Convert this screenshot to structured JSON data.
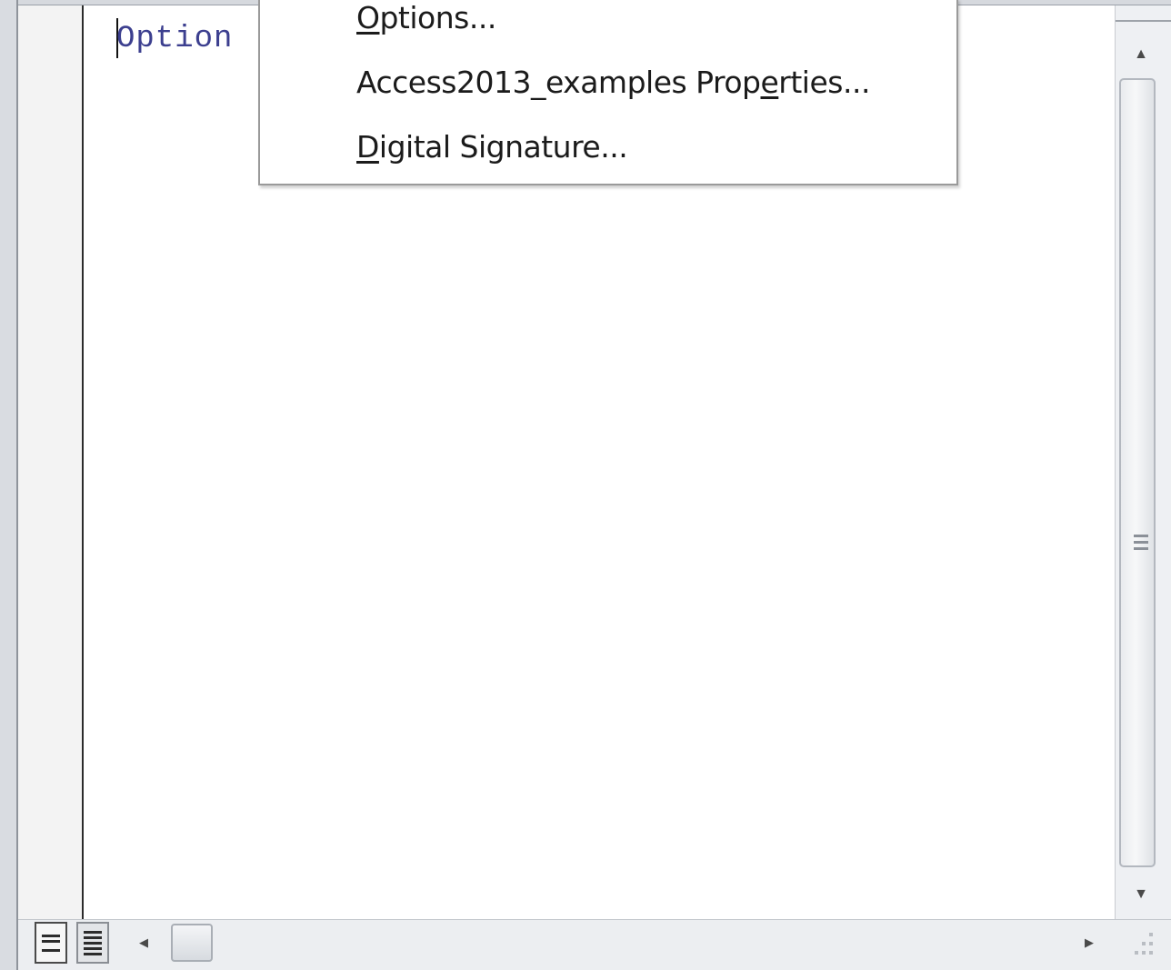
{
  "editor": {
    "code_text": "Option"
  },
  "context_menu": {
    "items": [
      {
        "mnemonic": "O",
        "rest": "ptions..."
      },
      {
        "before": "Access2013_examples Prop",
        "mnemonic": "e",
        "after": "rties..."
      },
      {
        "mnemonic": "D",
        "rest": "igital Signature..."
      }
    ]
  },
  "scrollbars": {
    "up_arrow": "▲",
    "down_arrow": "▼",
    "left_arrow": "◀",
    "right_arrow": "▶"
  },
  "icons": {
    "procedure_view": "procedure-view-icon",
    "full_module_view": "full-module-view-icon",
    "size_grip": "size-grip-icon"
  },
  "colors": {
    "code_text": "#3c3f8f",
    "menu_text": "#1b1b1b",
    "menu_border": "#9a9a9a"
  }
}
